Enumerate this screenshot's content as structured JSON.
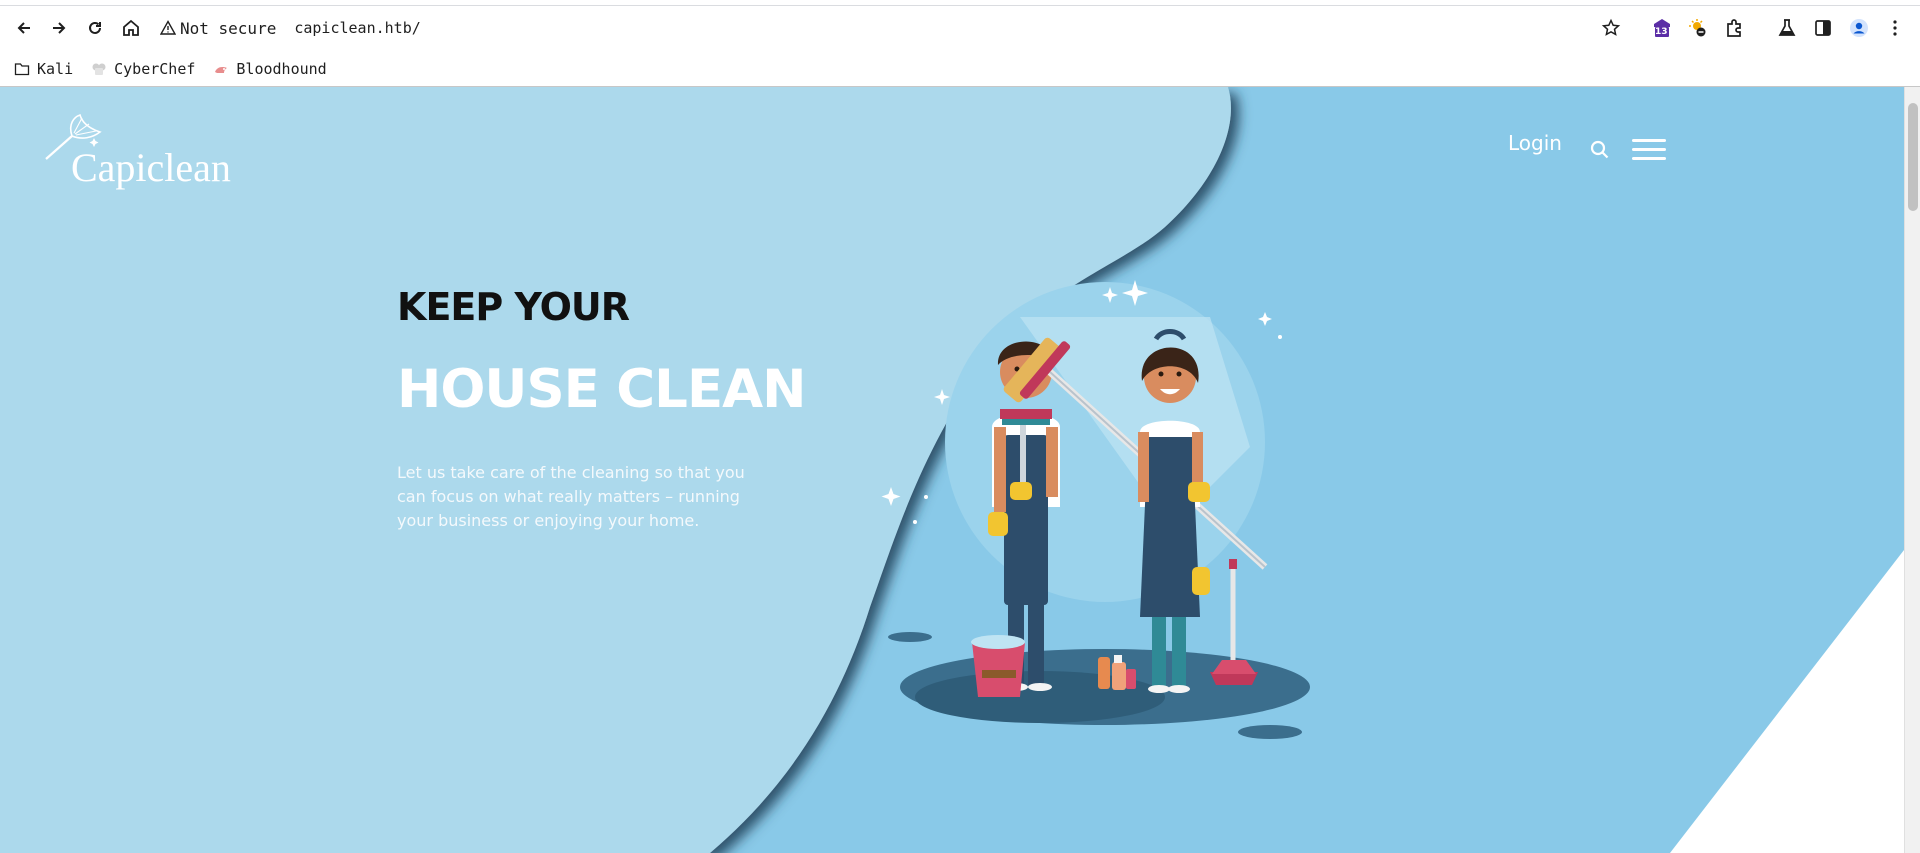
{
  "browser": {
    "security_label": "Not secure",
    "url": "capiclean.htb/",
    "extension_badge": "13",
    "bookmarks": [
      {
        "label": "Kali",
        "icon": "folder-icon"
      },
      {
        "label": "CyberChef",
        "icon": "chef-icon"
      },
      {
        "label": "Bloodhound",
        "icon": "bloodhound-icon"
      }
    ]
  },
  "site": {
    "logo_text": "Capiclean",
    "nav": {
      "login_label": "Login",
      "search_icon": "search-icon",
      "menu_icon": "hamburger-menu-icon"
    }
  },
  "hero": {
    "line1": "KEEP YOUR",
    "line2": "HOUSE CLEAN",
    "description": "Let us take care of the cleaning so that you can focus on what really matters – running your business or enjoying your home."
  },
  "colors": {
    "hero_light": "#acd9ec",
    "hero_mid": "#89c9e8",
    "heading_dark": "#111111",
    "white": "#ffffff"
  }
}
